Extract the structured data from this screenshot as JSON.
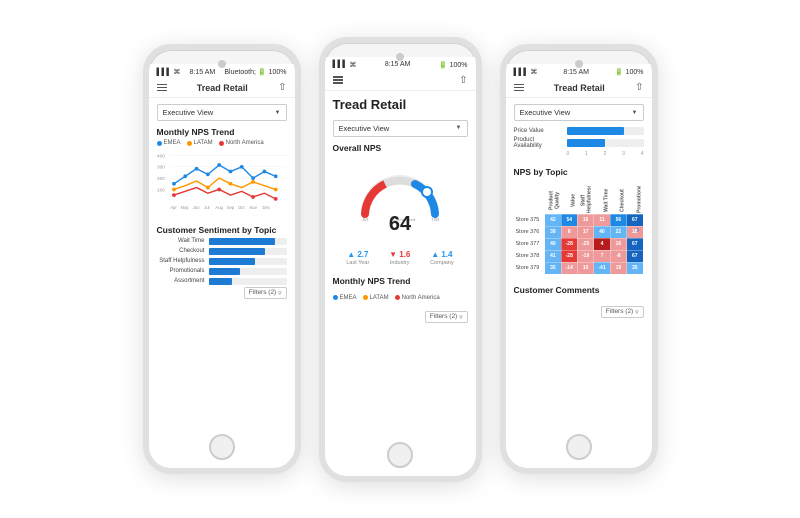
{
  "app": {
    "title": "Tread Retail",
    "status_time": "8:15 AM",
    "status_battery": "100%",
    "status_signal": "▌▌▌",
    "status_wifi": "WiFi"
  },
  "phone1": {
    "header_title": "Tread Retail",
    "dropdown_label": "Executive View",
    "section1_title": "Monthly NPS Trend",
    "legend": [
      {
        "label": "EMEA",
        "color": "#1e88e5"
      },
      {
        "label": "LATAM",
        "color": "#ff9800"
      },
      {
        "label": "North America",
        "color": "#e53935"
      }
    ],
    "section2_title": "Customer Sentiment by Topic",
    "sentiment_bars": [
      {
        "label": "Wait Time",
        "pct": 85
      },
      {
        "label": "Checkout",
        "pct": 72
      },
      {
        "label": "Staff Helpfulness",
        "pct": 60
      },
      {
        "label": "Promotionals",
        "pct": 40
      },
      {
        "label": "Assortment",
        "pct": 30
      }
    ],
    "filters_label": "Filters (2)"
  },
  "phone2": {
    "header_title": "Tread Retail",
    "page_title": "Tread Retail",
    "dropdown_label": "Executive View",
    "section_overall": "Overall NPS",
    "nps_score": "64",
    "gauge_min": "0",
    "gauge_max": "100",
    "gauge_excellent_label": "Excellent",
    "gauge_red_end": "-50",
    "gauge_green_start": "50",
    "metrics": [
      {
        "label": "Last Year",
        "value": "2.7",
        "direction": "up"
      },
      {
        "label": "Industry",
        "value": "1.6",
        "direction": "down"
      },
      {
        "label": "Company",
        "value": "1.4",
        "direction": "up"
      }
    ],
    "section2_title": "Monthly NPS Trend",
    "legend": [
      {
        "label": "EMEA",
        "color": "#1e88e5"
      },
      {
        "label": "LATAM",
        "color": "#ff9800"
      },
      {
        "label": "North America",
        "color": "#e53935"
      }
    ],
    "filters_label": "Filters (2)"
  },
  "phone3": {
    "header_title": "Tread Retail",
    "dropdown_label": "Executive View",
    "bars": [
      {
        "label": "Price Value",
        "pct": 75
      },
      {
        "label": "Product Availability",
        "pct": 50
      }
    ],
    "section_heatmap": "NPS by Topic",
    "heatmap_cols": [
      "Product Quality",
      "Value",
      "Staff Helpfulness",
      "Wait Time",
      "Checkout",
      "Promotionals"
    ],
    "heatmap_rows": [
      {
        "label": "Store 375",
        "values": [
          42,
          54,
          16,
          11,
          56,
          67
        ],
        "classes": [
          "hm-blue-light",
          "hm-blue",
          "hm-red-light",
          "hm-red-light",
          "hm-blue",
          "hm-blue-dark"
        ]
      },
      {
        "label": "Store 376",
        "values": [
          39,
          8,
          17,
          40,
          22,
          18
        ],
        "classes": [
          "hm-blue-light",
          "hm-red-light",
          "hm-red-light",
          "hm-blue-light",
          "hm-blue-light",
          "hm-red-light"
        ]
      },
      {
        "label": "Store 377",
        "values": [
          40,
          28,
          25,
          4,
          16,
          67
        ],
        "classes": [
          "hm-blue-light",
          "hm-red",
          "hm-red-light",
          "hm-red-dark",
          "hm-red-light",
          "hm-blue-dark"
        ]
      },
      {
        "label": "Store 378",
        "values": [
          41,
          28,
          19,
          7,
          8,
          67
        ],
        "classes": [
          "hm-blue-light",
          "hm-red",
          "hm-red-light",
          "hm-red-light",
          "hm-red-light",
          "hm-blue-dark"
        ]
      },
      {
        "label": "Store 379",
        "values": [
          35,
          14,
          10,
          41,
          19,
          35
        ],
        "classes": [
          "hm-blue-light",
          "hm-red-light",
          "hm-red-light",
          "hm-blue-light",
          "hm-red-light",
          "hm-blue-light"
        ]
      }
    ],
    "section2_title": "Customer Comments",
    "filters_label": "Filters (2)"
  }
}
